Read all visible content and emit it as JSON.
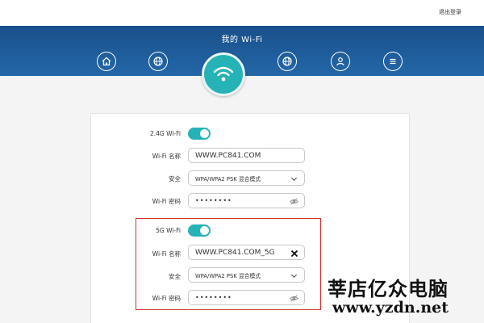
{
  "header": {
    "logout_label": "退出登录"
  },
  "banner": {
    "title": "我的 Wi-Fi",
    "nav_icons": [
      "home-icon",
      "globe-icon",
      "wifi-icon",
      "globe-speed-icon",
      "user-icon",
      "menu-icon"
    ]
  },
  "wifi24": {
    "toggle_label": "2.4G Wi-Fi",
    "enabled": true,
    "name_label": "Wi-Fi 名称",
    "name_value": "WWW.PC841.COM",
    "security_label": "安全",
    "security_value": "WPA/WPA2 PSK 混合模式",
    "password_label": "Wi-Fi 密码",
    "password_value": "••••••••"
  },
  "wifi5": {
    "toggle_label": "5G Wi-Fi",
    "enabled": true,
    "name_label": "Wi-Fi 名称",
    "name_value": "WWW.PC841.COM_5G",
    "security_label": "安全",
    "security_value": "WPA/WPA2 PSK 混合模式",
    "password_label": "Wi-Fi 密码",
    "password_value": "••••••••"
  },
  "watermark": {
    "chinese": "莘店亿众电脑",
    "url": "www.yzdn.net"
  },
  "colors": {
    "banner": "#1f5e9c",
    "accent": "#26b3b7",
    "highlight_box": "#d83030"
  }
}
